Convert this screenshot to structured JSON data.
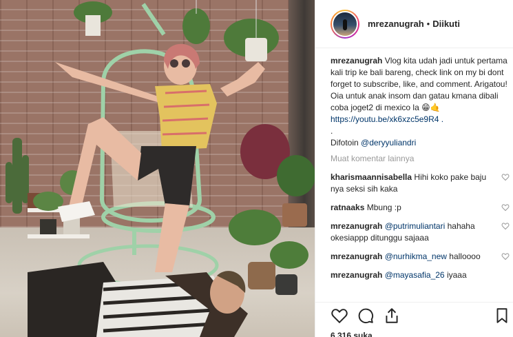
{
  "photo": {
    "subject": "photo-post"
  },
  "header": {
    "username": "mrezanugrah",
    "separator": "•",
    "follow_status": "Diikuti"
  },
  "caption": {
    "username": "mrezanugrah",
    "text": "Vlog kita udah jadi untuk pertama kali trip ke bali bareng, check link on my bi dont forget to subscribe, like, and comment. Arigatou! Oia untuk anak insom dan gatau kmana dibali coba joget2 di mexico la",
    "emoji": "😁🤙",
    "link": "https://youtu.be/xk6xzc5e9R4 .",
    "dot_line": ".",
    "credit_prefix": "Difotoin ",
    "credit_mention": "@deryyuliandri"
  },
  "load_more": "Muat komentar lainnya",
  "comments": [
    {
      "user": "kharismaannisabella",
      "mention": "",
      "text": "Hihi koko pake baju nya seksi sih kaka"
    },
    {
      "user": "ratnaaks",
      "mention": "",
      "text": "Mbung :p"
    },
    {
      "user": "mrezanugrah",
      "mention": "@putrimuliantari",
      "text": "hahaha okesiappp ditunggu sajaaa"
    },
    {
      "user": "mrezanugrah",
      "mention": "@nurhikma_new",
      "text": "halloooo"
    },
    {
      "user": "mrezanugrah",
      "mention": "@mayasafia_26",
      "text": "iyaaa"
    }
  ],
  "likes": "6.316 suka",
  "colors": {
    "link": "#003569",
    "muted": "#999999",
    "text": "#262626",
    "border": "#efefef"
  },
  "icons": [
    "heart-icon",
    "comment-icon",
    "share-icon",
    "bookmark-icon"
  ]
}
